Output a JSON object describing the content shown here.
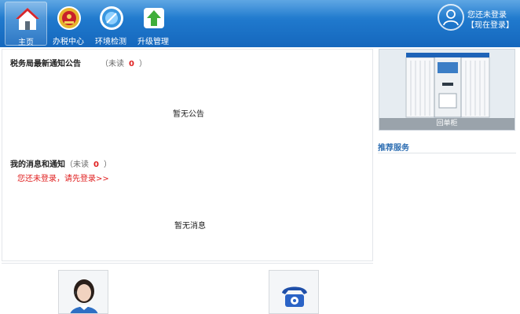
{
  "nav": {
    "items": [
      {
        "label": "主页",
        "icon": "home-icon"
      },
      {
        "label": "办税中心",
        "icon": "tax-emblem-icon"
      },
      {
        "label": "环境检测",
        "icon": "compass-icon"
      },
      {
        "label": "升级管理",
        "icon": "upgrade-arrow-icon"
      }
    ]
  },
  "user": {
    "status": "您还未登录",
    "login_link": "【现在登录】"
  },
  "announcements": {
    "title": "税务局最新通知公告",
    "unread_prefix": "（未读",
    "unread_count": "0",
    "unread_suffix": "）",
    "empty_text": "暂无公告"
  },
  "messages": {
    "title": "我的消息和通知",
    "unread_prefix": "（未读",
    "unread_count": "0",
    "unread_suffix": "）",
    "login_prompt": "您还未登录，请先登录>>",
    "empty_text": "暂无消息"
  },
  "sidebar": {
    "promo_label": "回单柜",
    "recommend_title": "推荐服务"
  },
  "colors": {
    "header_blue": "#1f78cc",
    "accent_red": "#e02020",
    "link_blue": "#2f6fb3"
  }
}
